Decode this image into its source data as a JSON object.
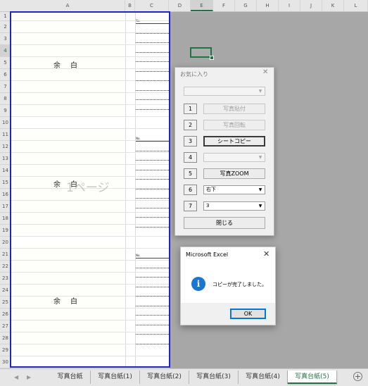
{
  "columns": [
    "A",
    "B",
    "C",
    "D",
    "E",
    "F",
    "G",
    "H",
    "I",
    "J",
    "K",
    "L"
  ],
  "selected_column": "E",
  "rows": [
    "1",
    "2",
    "3",
    "4",
    "5",
    "6",
    "7",
    "8",
    "9",
    "10",
    "11",
    "12",
    "13",
    "14",
    "15",
    "16",
    "17",
    "18",
    "19",
    "20",
    "21",
    "22",
    "23",
    "24",
    "25",
    "26",
    "27",
    "28",
    "29",
    "30"
  ],
  "selected_row": "4",
  "sheet": {
    "margin_text": "余白",
    "no_label": "No.",
    "page_watermark": "1ページ"
  },
  "favorites_dialog": {
    "title": "お気に入り",
    "close_glyph": "✕",
    "top_combo_value": "",
    "buttons": [
      {
        "num": "1",
        "label": "写真貼付",
        "enabled": false
      },
      {
        "num": "2",
        "label": "写真回転",
        "enabled": false
      },
      {
        "num": "3",
        "label": "シートコピー",
        "enabled": true
      },
      {
        "num": "4",
        "label": "",
        "enabled": false
      },
      {
        "num": "5",
        "label": "写真ZOOM",
        "enabled": true
      },
      {
        "num": "6",
        "label": "右下",
        "enabled": true
      },
      {
        "num": "7",
        "label": "3",
        "enabled": true
      }
    ],
    "close_label": "閉じる",
    "arrow_glyph": "▼"
  },
  "message_dialog": {
    "title": "Microsoft Excel",
    "close_glyph": "✕",
    "icon": "info-icon",
    "icon_glyph": "i",
    "message": "コピーが完了しました。",
    "ok_label": "OK"
  },
  "tabs": {
    "nav_prev": "◀",
    "nav_next": "▶",
    "sheets": [
      "写真台紙",
      "写真台紙(1)",
      "写真台紙(2)",
      "写真台紙(3)",
      "写真台紙(4)",
      "写真台紙(5)"
    ],
    "active_index": 5,
    "add_glyph": "+"
  },
  "colors": {
    "excel_green": "#217346",
    "page_break_blue": "#2222c8",
    "info_blue": "#1976d2",
    "gray_area": "#a7a7a7"
  }
}
